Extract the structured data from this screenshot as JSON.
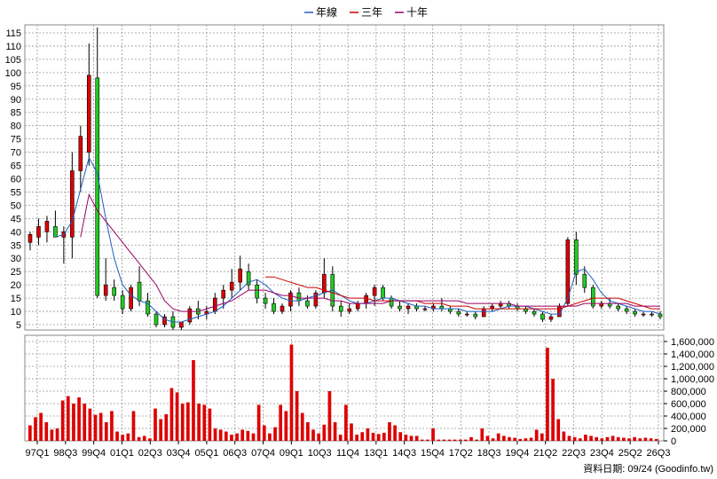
{
  "legend": [
    {
      "name": "年線",
      "color": "#1f5fbf"
    },
    {
      "name": "三年",
      "color": "#cc0000"
    },
    {
      "name": "十年",
      "color": "#990066"
    }
  ],
  "footer": "資料日期: 09/24  (Goodinfo.tw)",
  "colors": {
    "up": "#dd0000",
    "down": "#22cc22",
    "volume": "#dd0000",
    "grid": "#999999"
  },
  "chart_data": [
    {
      "type": "candlestick",
      "title": "",
      "ylim": [
        3,
        118
      ],
      "yticks": [
        5,
        10,
        15,
        20,
        25,
        30,
        35,
        40,
        45,
        50,
        55,
        60,
        65,
        70,
        75,
        80,
        85,
        90,
        95,
        100,
        105,
        110,
        115
      ],
      "grid": true,
      "legend_position": "top-center",
      "x_tick_labels": [
        "97Q1",
        "98Q3",
        "99Q4",
        "01Q1",
        "02Q3",
        "03Q4",
        "05Q1",
        "06Q3",
        "07Q4",
        "09Q1",
        "10Q3",
        "11Q4",
        "13Q1",
        "14Q3",
        "15Q4",
        "17Q2",
        "18Q3",
        "19Q4",
        "21Q2",
        "22Q3",
        "23Q4",
        "25Q2",
        "26Q3"
      ],
      "candles": [
        {
          "o": 36,
          "h": 40,
          "l": 33,
          "c": 39
        },
        {
          "o": 38,
          "h": 45,
          "l": 35,
          "c": 42
        },
        {
          "o": 40,
          "h": 46,
          "l": 36,
          "c": 44
        },
        {
          "o": 42,
          "h": 48,
          "l": 38,
          "c": 38
        },
        {
          "o": 38,
          "h": 42,
          "l": 28,
          "c": 40
        },
        {
          "o": 38,
          "h": 70,
          "l": 30,
          "c": 63
        },
        {
          "o": 63,
          "h": 80,
          "l": 55,
          "c": 76
        },
        {
          "o": 70,
          "h": 111,
          "l": 65,
          "c": 99
        },
        {
          "o": 98,
          "h": 117,
          "l": 15,
          "c": 16
        },
        {
          "o": 16,
          "h": 30,
          "l": 14,
          "c": 20
        },
        {
          "o": 19,
          "h": 22,
          "l": 14,
          "c": 16
        },
        {
          "o": 16,
          "h": 18,
          "l": 9,
          "c": 11
        },
        {
          "o": 11,
          "h": 20,
          "l": 10,
          "c": 19
        },
        {
          "o": 21,
          "h": 27,
          "l": 12,
          "c": 14
        },
        {
          "o": 14,
          "h": 17,
          "l": 8,
          "c": 9
        },
        {
          "o": 9,
          "h": 10,
          "l": 4,
          "c": 5
        },
        {
          "o": 5,
          "h": 9,
          "l": 4,
          "c": 8
        },
        {
          "o": 8,
          "h": 10,
          "l": 3,
          "c": 4
        },
        {
          "o": 4,
          "h": 6,
          "l": 3,
          "c": 6
        },
        {
          "o": 6,
          "h": 12,
          "l": 5,
          "c": 11
        },
        {
          "o": 11,
          "h": 14,
          "l": 7,
          "c": 9
        },
        {
          "o": 9,
          "h": 12,
          "l": 7,
          "c": 10
        },
        {
          "o": 10,
          "h": 17,
          "l": 9,
          "c": 15
        },
        {
          "o": 15,
          "h": 20,
          "l": 11,
          "c": 18
        },
        {
          "o": 18,
          "h": 26,
          "l": 15,
          "c": 21
        },
        {
          "o": 21,
          "h": 31,
          "l": 18,
          "c": 26
        },
        {
          "o": 25,
          "h": 28,
          "l": 18,
          "c": 20
        },
        {
          "o": 20,
          "h": 22,
          "l": 13,
          "c": 15
        },
        {
          "o": 15,
          "h": 17,
          "l": 11,
          "c": 13
        },
        {
          "o": 13,
          "h": 15,
          "l": 9,
          "c": 10
        },
        {
          "o": 10,
          "h": 13,
          "l": 9,
          "c": 12
        },
        {
          "o": 12,
          "h": 18,
          "l": 10,
          "c": 17
        },
        {
          "o": 17,
          "h": 19,
          "l": 12,
          "c": 14
        },
        {
          "o": 14,
          "h": 16,
          "l": 11,
          "c": 12
        },
        {
          "o": 12,
          "h": 18,
          "l": 11,
          "c": 17
        },
        {
          "o": 17,
          "h": 30,
          "l": 15,
          "c": 24
        },
        {
          "o": 24,
          "h": 27,
          "l": 10,
          "c": 12
        },
        {
          "o": 12,
          "h": 14,
          "l": 8,
          "c": 10
        },
        {
          "o": 10,
          "h": 13,
          "l": 9,
          "c": 11
        },
        {
          "o": 11,
          "h": 14,
          "l": 10,
          "c": 13
        },
        {
          "o": 13,
          "h": 17,
          "l": 11,
          "c": 16
        },
        {
          "o": 16,
          "h": 20,
          "l": 12,
          "c": 19
        },
        {
          "o": 19,
          "h": 20,
          "l": 14,
          "c": 15
        },
        {
          "o": 15,
          "h": 16,
          "l": 11,
          "c": 12
        },
        {
          "o": 12,
          "h": 14,
          "l": 10,
          "c": 11
        },
        {
          "o": 11,
          "h": 13,
          "l": 9,
          "c": 12
        },
        {
          "o": 12,
          "h": 13,
          "l": 10,
          "c": 11
        },
        {
          "o": 11,
          "h": 12,
          "l": 10,
          "c": 11
        },
        {
          "o": 11,
          "h": 13,
          "l": 10,
          "c": 12
        },
        {
          "o": 12,
          "h": 15,
          "l": 10,
          "c": 11
        },
        {
          "o": 11,
          "h": 12,
          "l": 9,
          "c": 10
        },
        {
          "o": 10,
          "h": 11,
          "l": 8,
          "c": 9
        },
        {
          "o": 9,
          "h": 10,
          "l": 8,
          "c": 9
        },
        {
          "o": 9,
          "h": 10,
          "l": 7,
          "c": 8
        },
        {
          "o": 8,
          "h": 12,
          "l": 8,
          "c": 11
        },
        {
          "o": 11,
          "h": 13,
          "l": 10,
          "c": 12
        },
        {
          "o": 12,
          "h": 14,
          "l": 11,
          "c": 13
        },
        {
          "o": 13,
          "h": 14,
          "l": 11,
          "c": 12
        },
        {
          "o": 12,
          "h": 13,
          "l": 10,
          "c": 11
        },
        {
          "o": 11,
          "h": 12,
          "l": 9,
          "c": 10
        },
        {
          "o": 10,
          "h": 11,
          "l": 8,
          "c": 9
        },
        {
          "o": 9,
          "h": 10,
          "l": 6,
          "c": 7
        },
        {
          "o": 7,
          "h": 9,
          "l": 6,
          "c": 8
        },
        {
          "o": 8,
          "h": 13,
          "l": 8,
          "c": 12
        },
        {
          "o": 13,
          "h": 38,
          "l": 12,
          "c": 37
        },
        {
          "o": 37,
          "h": 40,
          "l": 20,
          "c": 24
        },
        {
          "o": 24,
          "h": 27,
          "l": 17,
          "c": 19
        },
        {
          "o": 19,
          "h": 20,
          "l": 11,
          "c": 12
        },
        {
          "o": 12,
          "h": 14,
          "l": 11,
          "c": 13
        },
        {
          "o": 13,
          "h": 15,
          "l": 11,
          "c": 12
        },
        {
          "o": 12,
          "h": 13,
          "l": 10,
          "c": 11
        },
        {
          "o": 11,
          "h": 12,
          "l": 9,
          "c": 10
        },
        {
          "o": 10,
          "h": 11,
          "l": 8,
          "c": 9
        },
        {
          "o": 9,
          "h": 10,
          "l": 8,
          "c": 9
        },
        {
          "o": 9,
          "h": 10,
          "l": 8,
          "c": 9
        },
        {
          "o": 9,
          "h": 10,
          "l": 7,
          "c": 8
        }
      ],
      "series": [
        {
          "name": "年線",
          "values": [
            null,
            null,
            null,
            38,
            39,
            44,
            56,
            68,
            62,
            45,
            30,
            20,
            16,
            14,
            13,
            10,
            7,
            6,
            6,
            7,
            8,
            9,
            10,
            12,
            15,
            18,
            21,
            22,
            20,
            17,
            15,
            14,
            14,
            15,
            16,
            17,
            18,
            16,
            14,
            13,
            13,
            14,
            15,
            15,
            14,
            13,
            12,
            12,
            11,
            11,
            11,
            11,
            10,
            10,
            10,
            10,
            11,
            12,
            12,
            12,
            11,
            10,
            9,
            9,
            15,
            25,
            26,
            22,
            17,
            14,
            13,
            12,
            11,
            10,
            10,
            9,
            9
          ]
        },
        {
          "name": "三年",
          "values": [
            null,
            null,
            null,
            null,
            null,
            null,
            null,
            null,
            null,
            null,
            null,
            null,
            null,
            null,
            null,
            null,
            null,
            null,
            null,
            null,
            null,
            null,
            null,
            null,
            null,
            null,
            null,
            null,
            23,
            23,
            22,
            21,
            20,
            19,
            19,
            18,
            17,
            16,
            15,
            15,
            15,
            14,
            14,
            14,
            14,
            14,
            14,
            13,
            13,
            13,
            12,
            12,
            12,
            11,
            11,
            11,
            11,
            11,
            11,
            11,
            11,
            11,
            11,
            11,
            12,
            13,
            14,
            15,
            15,
            15,
            15,
            14,
            13,
            12,
            11,
            11,
            11
          ]
        },
        {
          "name": "十年",
          "values": [
            null,
            null,
            null,
            null,
            null,
            null,
            38,
            54,
            48,
            44,
            40,
            36,
            32,
            28,
            24,
            20,
            14,
            11,
            10,
            10,
            10,
            11,
            12,
            13,
            14,
            16,
            18,
            18,
            18,
            17,
            16,
            16,
            15,
            15,
            15,
            15,
            14,
            14,
            13,
            13,
            13,
            13,
            13,
            14,
            14,
            14,
            14,
            14,
            14,
            14,
            14,
            14,
            13,
            13,
            13,
            13,
            13,
            13,
            12,
            12,
            12,
            12,
            12,
            12,
            12,
            12,
            13,
            13,
            13,
            13,
            13,
            13,
            12,
            12,
            12,
            12,
            12
          ]
        }
      ]
    },
    {
      "type": "bar",
      "title": "",
      "ylim": [
        0,
        1700000
      ],
      "yticks": [
        0,
        200000,
        400000,
        600000,
        800000,
        1000000,
        1200000,
        1400000,
        1600000
      ],
      "ytick_labels": [
        "0",
        "200,000",
        "400,000",
        "600,000",
        "800,000",
        "1,000,000",
        "1,200,000",
        "1,400,000",
        "1,600,000"
      ],
      "values": [
        250000,
        380000,
        450000,
        300000,
        180000,
        200000,
        650000,
        720000,
        600000,
        700000,
        600000,
        520000,
        420000,
        450000,
        300000,
        480000,
        150000,
        100000,
        120000,
        480000,
        60000,
        80000,
        40000,
        520000,
        350000,
        430000,
        850000,
        780000,
        600000,
        620000,
        1300000,
        600000,
        580000,
        520000,
        200000,
        180000,
        150000,
        100000,
        120000,
        180000,
        160000,
        120000,
        580000,
        250000,
        120000,
        220000,
        580000,
        480000,
        1550000,
        800000,
        450000,
        300000,
        180000,
        120000,
        260000,
        800000,
        300000,
        100000,
        580000,
        280000,
        100000,
        140000,
        200000,
        130000,
        110000,
        130000,
        300000,
        250000,
        140000,
        100000,
        80000,
        80000,
        20000,
        20000,
        200000,
        20000,
        20000,
        20000,
        20000,
        20000,
        20000,
        60000,
        20000,
        200000,
        80000,
        40000,
        120000,
        80000,
        60000,
        50000,
        30000,
        40000,
        50000,
        180000,
        120000,
        1500000,
        1000000,
        350000,
        150000,
        80000,
        60000,
        40000,
        100000,
        80000,
        60000,
        40000,
        60000,
        80000,
        60000,
        50000,
        40000,
        60000,
        40000,
        50000,
        40000,
        30000
      ]
    }
  ]
}
